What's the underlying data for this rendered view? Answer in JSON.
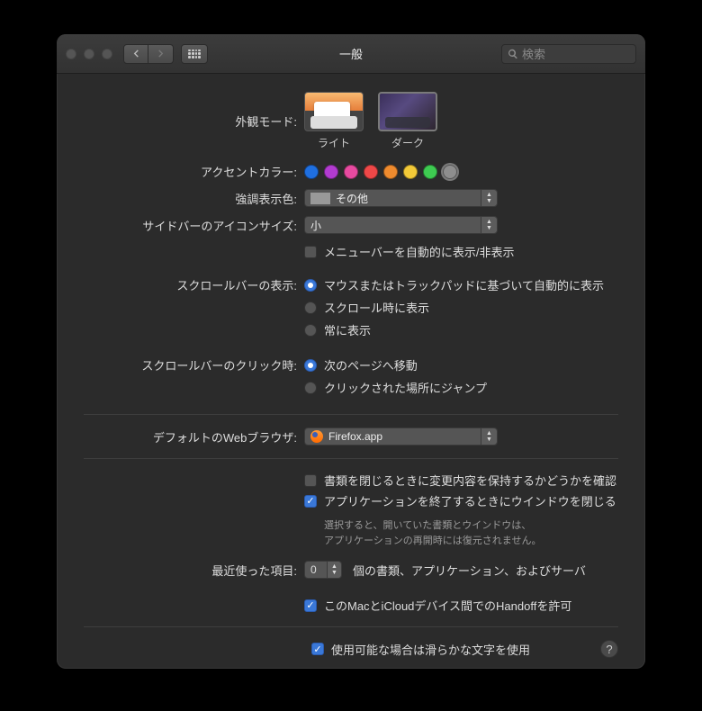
{
  "window": {
    "title": "一般",
    "search_placeholder": "検索"
  },
  "appearance": {
    "label": "外観モード:",
    "light_label": "ライト",
    "dark_label": "ダーク",
    "selected": "dark"
  },
  "accent": {
    "label": "アクセントカラー:",
    "colors": [
      "#1f6fe0",
      "#b23bd0",
      "#e84aa0",
      "#ef4848",
      "#ef8b2e",
      "#f2c938",
      "#3ecb51",
      "#8e8e8e"
    ],
    "selected_index": 7
  },
  "highlight": {
    "label": "強調表示色:",
    "value": "その他"
  },
  "sidebar": {
    "label": "サイドバーのアイコンサイズ:",
    "value": "小"
  },
  "menubar_autohide": {
    "label": "メニューバーを自動的に表示/非表示",
    "checked": false
  },
  "scrollbar_show": {
    "label": "スクロールバーの表示:",
    "options": [
      "マウスまたはトラックパッドに基づいて自動的に表示",
      "スクロール時に表示",
      "常に表示"
    ],
    "selected_index": 0
  },
  "scrollbar_click": {
    "label": "スクロールバーのクリック時:",
    "options": [
      "次のページへ移動",
      "クリックされた場所にジャンプ"
    ],
    "selected_index": 0
  },
  "browser": {
    "label": "デフォルトのWebブラウザ:",
    "value": "Firefox.app"
  },
  "close_docs": {
    "label": "書類を閉じるときに変更内容を保持するかどうかを確認",
    "checked": false
  },
  "close_windows": {
    "label": "アプリケーションを終了するときにウインドウを閉じる",
    "checked": true,
    "hint1": "選択すると、開いていた書類とウインドウは、",
    "hint2": "アプリケーションの再開時には復元されません。"
  },
  "recent": {
    "label": "最近使った項目:",
    "value": "0",
    "suffix": "個の書類、アプリケーション、およびサーバ"
  },
  "handoff": {
    "label": "このMacとiCloudデバイス間でのHandoffを許可",
    "checked": true
  },
  "font_smoothing": {
    "label": "使用可能な場合は滑らかな文字を使用",
    "checked": true
  },
  "help": "?"
}
